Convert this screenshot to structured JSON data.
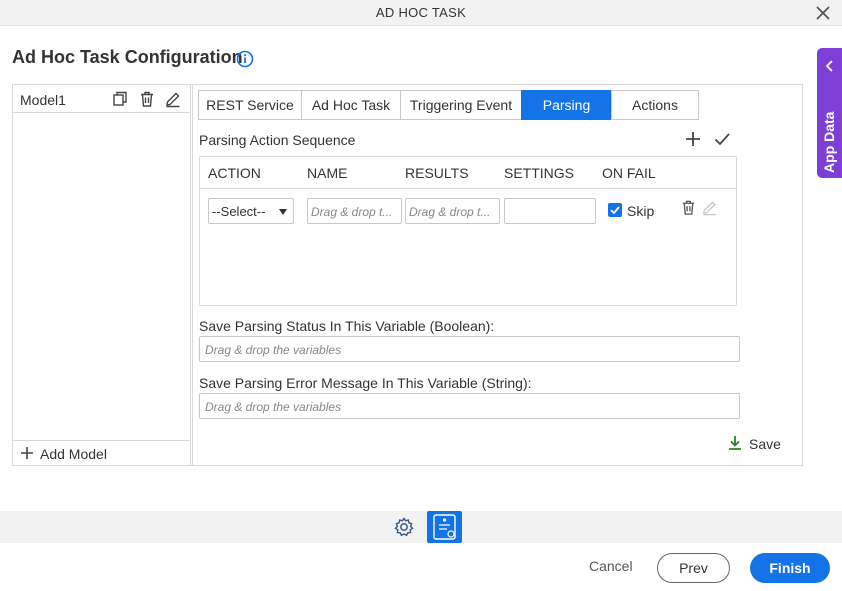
{
  "window": {
    "title": "AD HOC TASK",
    "close_icon": "close-icon"
  },
  "header": {
    "title": "Ad Hoc Task Configuration",
    "info_icon": "info-icon"
  },
  "side_tab": {
    "label": "App Data",
    "icon": "chevron-left-icon",
    "color": "#7d3fd6"
  },
  "models": {
    "items": [
      {
        "name": "Model1"
      }
    ],
    "row_icons": [
      "copy-icon",
      "trash-icon",
      "edit-icon"
    ],
    "add_label": "Add Model"
  },
  "tabs": [
    {
      "label": "REST Service",
      "active": false
    },
    {
      "label": "Ad Hoc Task",
      "active": false
    },
    {
      "label": "Triggering Event",
      "active": false
    },
    {
      "label": "Parsing",
      "active": true
    },
    {
      "label": "Actions",
      "active": false
    }
  ],
  "parsing": {
    "section_title": "Parsing Action Sequence",
    "columns": [
      "ACTION",
      "NAME",
      "RESULTS",
      "SETTINGS",
      "ON FAIL"
    ],
    "rows": [
      {
        "action": "--Select--",
        "name_placeholder": "Drag & drop t...",
        "results_placeholder": "Drag & drop t...",
        "settings": "",
        "on_fail_checked": true,
        "on_fail_label": "Skip"
      }
    ],
    "status_var_label": "Save Parsing Status In This Variable (Boolean):",
    "status_var_placeholder": "Drag & drop the variables",
    "error_var_label": "Save Parsing Error Message In This Variable (String):",
    "error_var_placeholder": "Drag & drop the variables",
    "save_label": "Save"
  },
  "footer": {
    "cancel_label": "Cancel",
    "prev_label": "Prev",
    "finish_label": "Finish"
  },
  "colors": {
    "accent": "#1473e6",
    "app_data": "#7d3fd6",
    "save_icon": "#2e7d32"
  }
}
